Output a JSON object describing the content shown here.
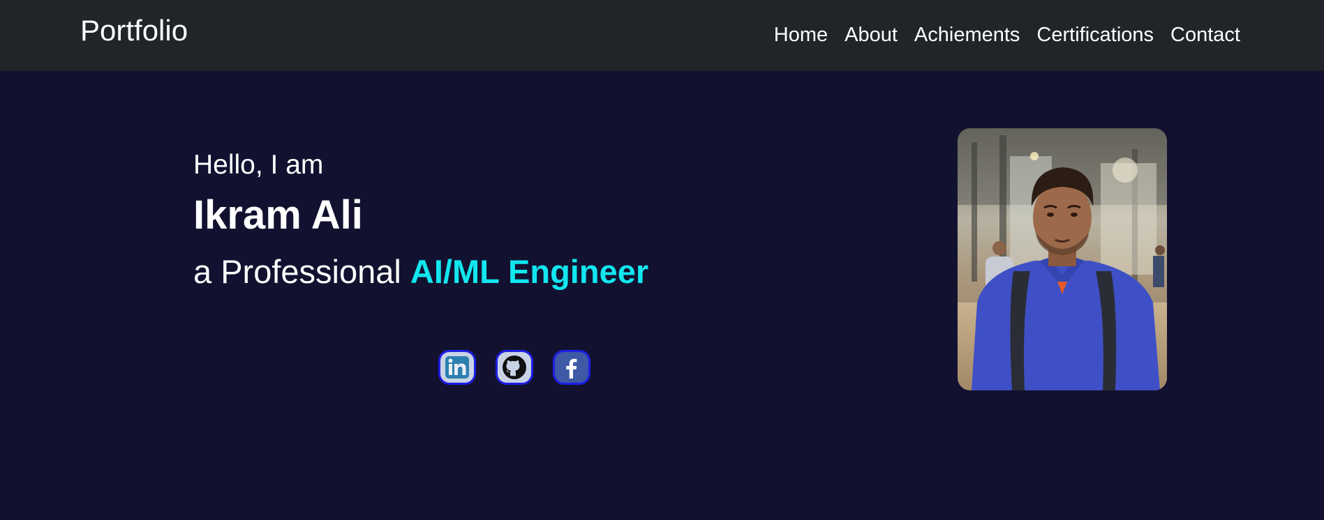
{
  "navbar": {
    "brand": "Portfolio",
    "links": [
      {
        "label": "Home"
      },
      {
        "label": "About"
      },
      {
        "label": "Achiements"
      },
      {
        "label": "Certifications"
      },
      {
        "label": "Contact"
      }
    ]
  },
  "hero": {
    "greeting": "Hello, I am",
    "name": "Ikram Ali",
    "tagline_prefix": "a Professional",
    "role": "AI/ML Engineer",
    "role_color": "#12e6ef"
  },
  "socials": [
    {
      "icon": "linkedin-icon"
    },
    {
      "icon": "github-icon"
    },
    {
      "icon": "facebook-icon"
    }
  ],
  "colors": {
    "navbar_bg": "#212529",
    "page_bg": "#121230",
    "social_border": "#1e1ee6"
  }
}
